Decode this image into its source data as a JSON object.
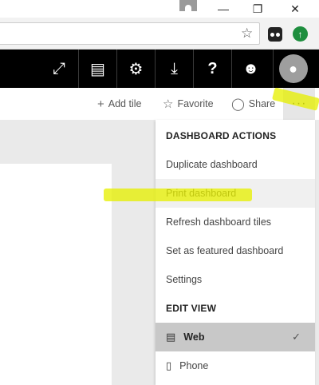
{
  "toolbar": {
    "add_tile": "Add tile",
    "favorite": "Favorite",
    "share": "Share",
    "more": "···"
  },
  "appbar": {
    "icons": [
      "expand-icon",
      "comment-icon",
      "gear-icon",
      "download-icon",
      "help-icon",
      "smiley-icon",
      "user-icon"
    ]
  },
  "menu": {
    "section1": "DASHBOARD ACTIONS",
    "items": [
      "Duplicate dashboard",
      "Print dashboard",
      "Refresh dashboard tiles",
      "Set as featured dashboard",
      "Settings"
    ],
    "section2": "EDIT VIEW",
    "views": [
      {
        "label": "Web",
        "selected": true
      },
      {
        "label": "Phone",
        "selected": false
      }
    ]
  },
  "colors": {
    "appbar": "#000000",
    "highlight": "#e6f000",
    "selected_bg": "#c8c8c8"
  }
}
